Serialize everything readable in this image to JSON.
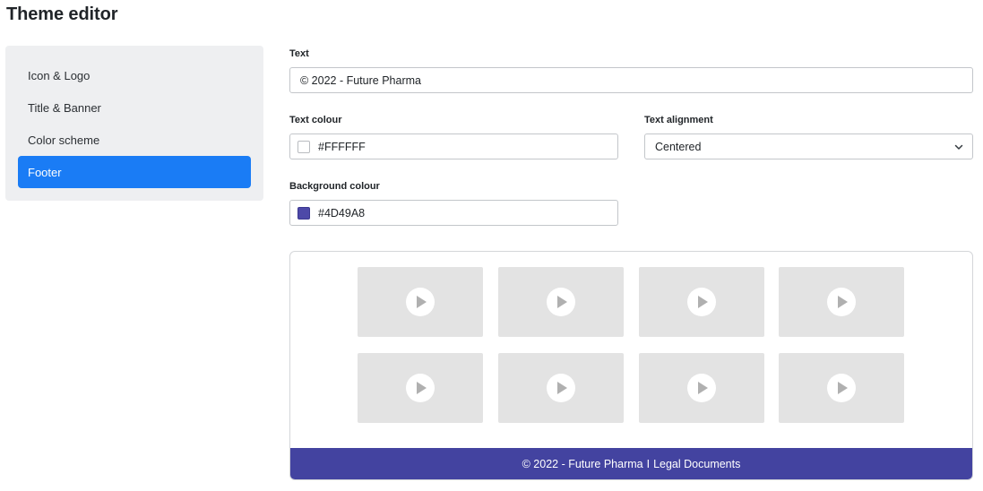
{
  "page": {
    "title": "Theme editor"
  },
  "sidebar": {
    "items": [
      {
        "label": "Icon & Logo",
        "active": false
      },
      {
        "label": "Title & Banner",
        "active": false
      },
      {
        "label": "Color scheme",
        "active": false
      },
      {
        "label": "Footer",
        "active": true
      }
    ]
  },
  "form": {
    "text": {
      "label": "Text",
      "value": "© 2022 - Future Pharma"
    },
    "text_colour": {
      "label": "Text colour",
      "value": "#FFFFFF"
    },
    "text_alignment": {
      "label": "Text alignment",
      "value": "Centered",
      "icon": "chevron-down-icon"
    },
    "background_colour": {
      "label": "Background colour",
      "value": "#4D49A8"
    }
  },
  "preview": {
    "thumbnails_icon": "play-icon",
    "footer": {
      "copyright": "© 2022 - Future Pharma",
      "separator": "I",
      "legal_link": "Legal Documents",
      "background": "#4343A0",
      "text_color": "#FFFFFF"
    }
  },
  "colors": {
    "accent": "#1A7CF5",
    "sidebar_bg": "#EEEFF1",
    "thumbnail_bg": "#E3E3E3",
    "play_arrow": "#B0B0B0"
  }
}
